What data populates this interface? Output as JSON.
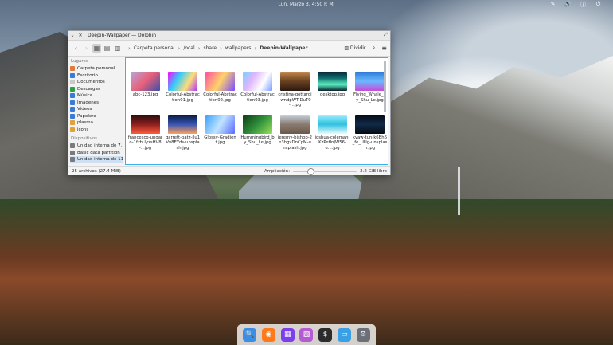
{
  "topbar": {
    "clock": "Lun, Marzo 3, 4:50 P. M.",
    "tray_icons": [
      "pen-icon",
      "volume-icon",
      "info-icon",
      "power-icon"
    ]
  },
  "window": {
    "title": "Deepin-Wallpaper — Dolphin",
    "toolbar": {
      "breadcrumbs": [
        "Carpeta personal",
        "/ocal",
        "share",
        "wallpapers",
        "Deepin-Wallpaper"
      ],
      "split_label": "Dividir"
    },
    "sidebar": {
      "places_header": "Lugares",
      "places": [
        {
          "label": "Carpeta personal",
          "color": "#e07b39"
        },
        {
          "label": "Escritorio",
          "color": "#3b7bd6"
        },
        {
          "label": "Documentos",
          "color": "#c9c9c9"
        },
        {
          "label": "Descargas",
          "color": "#2e9e4a"
        },
        {
          "label": "Música",
          "color": "#3b7bd6"
        },
        {
          "label": "Imágenes",
          "color": "#3b7bd6"
        },
        {
          "label": "Vídeos",
          "color": "#3b7bd6"
        },
        {
          "label": "Papelera",
          "color": "#3b7bd6"
        },
        {
          "label": "plasma",
          "color": "#e0a23a"
        },
        {
          "label": "icons",
          "color": "#e0a23a"
        }
      ],
      "devices_header": "Dispositivos",
      "devices": [
        {
          "label": "Unidad interna de 7...",
          "color": "#7a7a7a"
        },
        {
          "label": "Basic data partition",
          "color": "#7a7a7a"
        },
        {
          "label": "Unidad interna de 11...",
          "color": "#7a7a7a"
        }
      ]
    },
    "files": [
      {
        "name": "abc-123.jpg",
        "thumb": "linear-gradient(135deg,#b9a5d8,#e8607a,#3a4fa8)"
      },
      {
        "name": "Colorful-Abstraction01.jpg",
        "thumb": "linear-gradient(120deg,#f0f,#3cf,#fd7,#a3f)"
      },
      {
        "name": "Colorful-Abstraction02.jpg",
        "thumb": "linear-gradient(120deg,#ff4f9e,#ffd36b,#7c4dff)"
      },
      {
        "name": "Colorful-Abstraction03.jpg",
        "thumb": "linear-gradient(120deg,#6fd3ff,#e0b6ff,#fff,#7b9cff)"
      },
      {
        "name": "cristina-gottardi-wndpWTiDuT0-...jpg",
        "thumb": "linear-gradient(180deg,#c38a4e,#6a4020,#2b1a10)"
      },
      {
        "name": "desktop.jpg",
        "thumb": "linear-gradient(180deg,#062a3a,#0f6b6b,#5af0c0,#0b2130)"
      },
      {
        "name": "Flying_Whale_by_Shu_Le.jpg",
        "thumb": "linear-gradient(180deg,#2c7ad8,#6bb8ff,#c84bd6)"
      },
      {
        "name": "francesco-ungaro-1fzbUyzsHV8-...jpg",
        "thumb": "linear-gradient(180deg,#2a0d0d,#8b1e1e,#ff5a3c)"
      },
      {
        "name": "garrett-patz-ilu1Vv8EYds-unsplash.jpg",
        "thumb": "linear-gradient(180deg,#0c1840,#3454b4,#ffa05a)"
      },
      {
        "name": "Glossy-Gradient.jpg",
        "thumb": "linear-gradient(120deg,#3aa0ff,#c0e4ff,#5b6bff)"
      },
      {
        "name": "Hummingbird_by_Shu_Le.jpg",
        "thumb": "linear-gradient(135deg,#0d3a18,#2f8f3a,#98e05a)"
      },
      {
        "name": "jeremy-bishop-2e3hgvDnCpM-unsplash.jpg",
        "thumb": "linear-gradient(180deg,#c6d3de,#8a7b72,#6b5a4a)"
      },
      {
        "name": "joshua-coleman-KzPefInJW56-u....jpg",
        "thumb": "linear-gradient(180deg,#9ff0ff,#2fc0e0,#e8fbff)"
      },
      {
        "name": "kyaw-tun-k6Bh6_fe_UUg-unsplash.jpg",
        "thumb": "linear-gradient(180deg,#050a14,#102a48,#050a14)"
      }
    ],
    "status": {
      "count": "25 archivos (27.4 MiB)",
      "zoom_label": "Ampliación:",
      "zoom_fraction": 0.25,
      "free": "2.2 GiB libre"
    }
  },
  "dock": [
    {
      "name": "launcher-icon",
      "color": "#3a8ee6",
      "glyph": "🔍"
    },
    {
      "name": "firefox-icon",
      "color": "#ff7a1a",
      "glyph": "◉"
    },
    {
      "name": "store-icon",
      "color": "#7b3ff0",
      "glyph": "▦"
    },
    {
      "name": "image-viewer-icon",
      "color": "#b45bd1",
      "glyph": "▧"
    },
    {
      "name": "terminal-icon",
      "color": "#2b2b2b",
      "glyph": "$"
    },
    {
      "name": "file-manager-icon",
      "color": "#3aa0e6",
      "glyph": "▭"
    },
    {
      "name": "settings-icon",
      "color": "#6a6f78",
      "glyph": "⚙"
    }
  ]
}
